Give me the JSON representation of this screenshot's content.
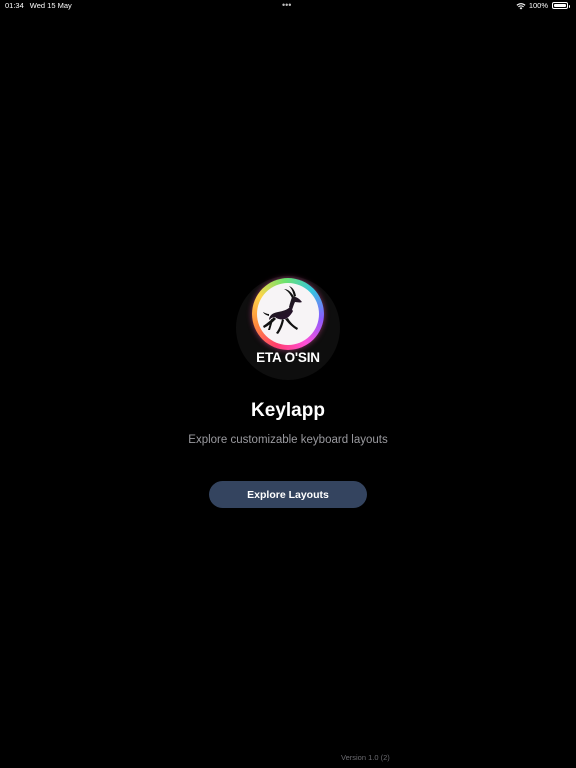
{
  "status_bar": {
    "time": "01:34",
    "date": "Wed 15 May",
    "center_dots": "•••",
    "battery_percent": "100%",
    "icons": [
      "wifi-icon",
      "battery-icon"
    ]
  },
  "logo": {
    "text": "ETA O'SIN",
    "icon": "gazelle-logo-icon",
    "colors": {
      "ring": [
        "#ff3d6e",
        "#ff8a3d",
        "#ffd54a",
        "#6de36d",
        "#36c6e0",
        "#8a5cff",
        "#ff4fd8"
      ],
      "inner": "#f7f4f6",
      "figure": "#111111"
    }
  },
  "app": {
    "title": "Keylapp",
    "subtitle": "Explore customizable keyboard layouts"
  },
  "actions": {
    "explore_label": "Explore Layouts"
  },
  "footer": {
    "version": "Version 1.0 (2)"
  },
  "colors": {
    "background": "#000000",
    "button": "#34445f",
    "subtitle": "#9a9a9f",
    "version": "#6b6b70"
  }
}
